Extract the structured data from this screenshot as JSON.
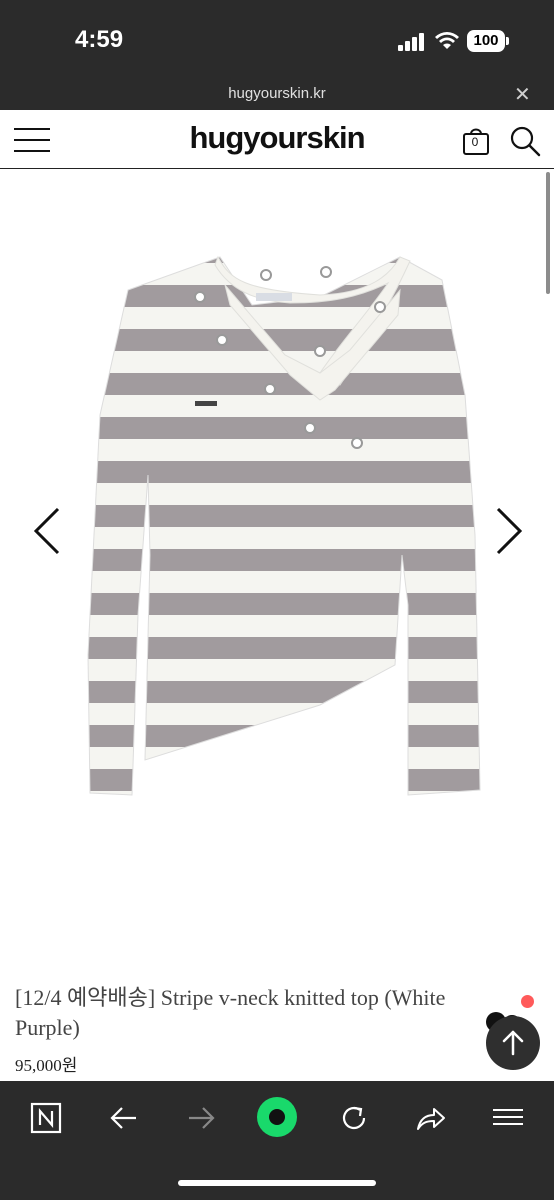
{
  "status_bar": {
    "time": "4:59",
    "battery": "100"
  },
  "browser": {
    "url": "hugyourskin.kr",
    "close_icon": "close-icon"
  },
  "header": {
    "logo": "hugyourskin",
    "cart_count": "0"
  },
  "product": {
    "title": "[12/4 예약배송] Stripe v-neck knitted top (White Purple)",
    "price": "95,000원"
  },
  "colors": {
    "stripe_purple": "#a19b9e",
    "stripe_white": "#f5f5f1",
    "bottom_bar": "#2b2b2b",
    "naver_green": "#19d96b",
    "notification": "#ff5a5a"
  },
  "icons": [
    "menu-icon",
    "cart-icon",
    "search-icon",
    "chevron-left-icon",
    "chevron-right-icon",
    "arrow-up-icon",
    "naver-n-icon",
    "back-arrow-icon",
    "forward-arrow-icon",
    "green-circle-icon",
    "refresh-icon",
    "share-icon",
    "hamburger-icon"
  ]
}
